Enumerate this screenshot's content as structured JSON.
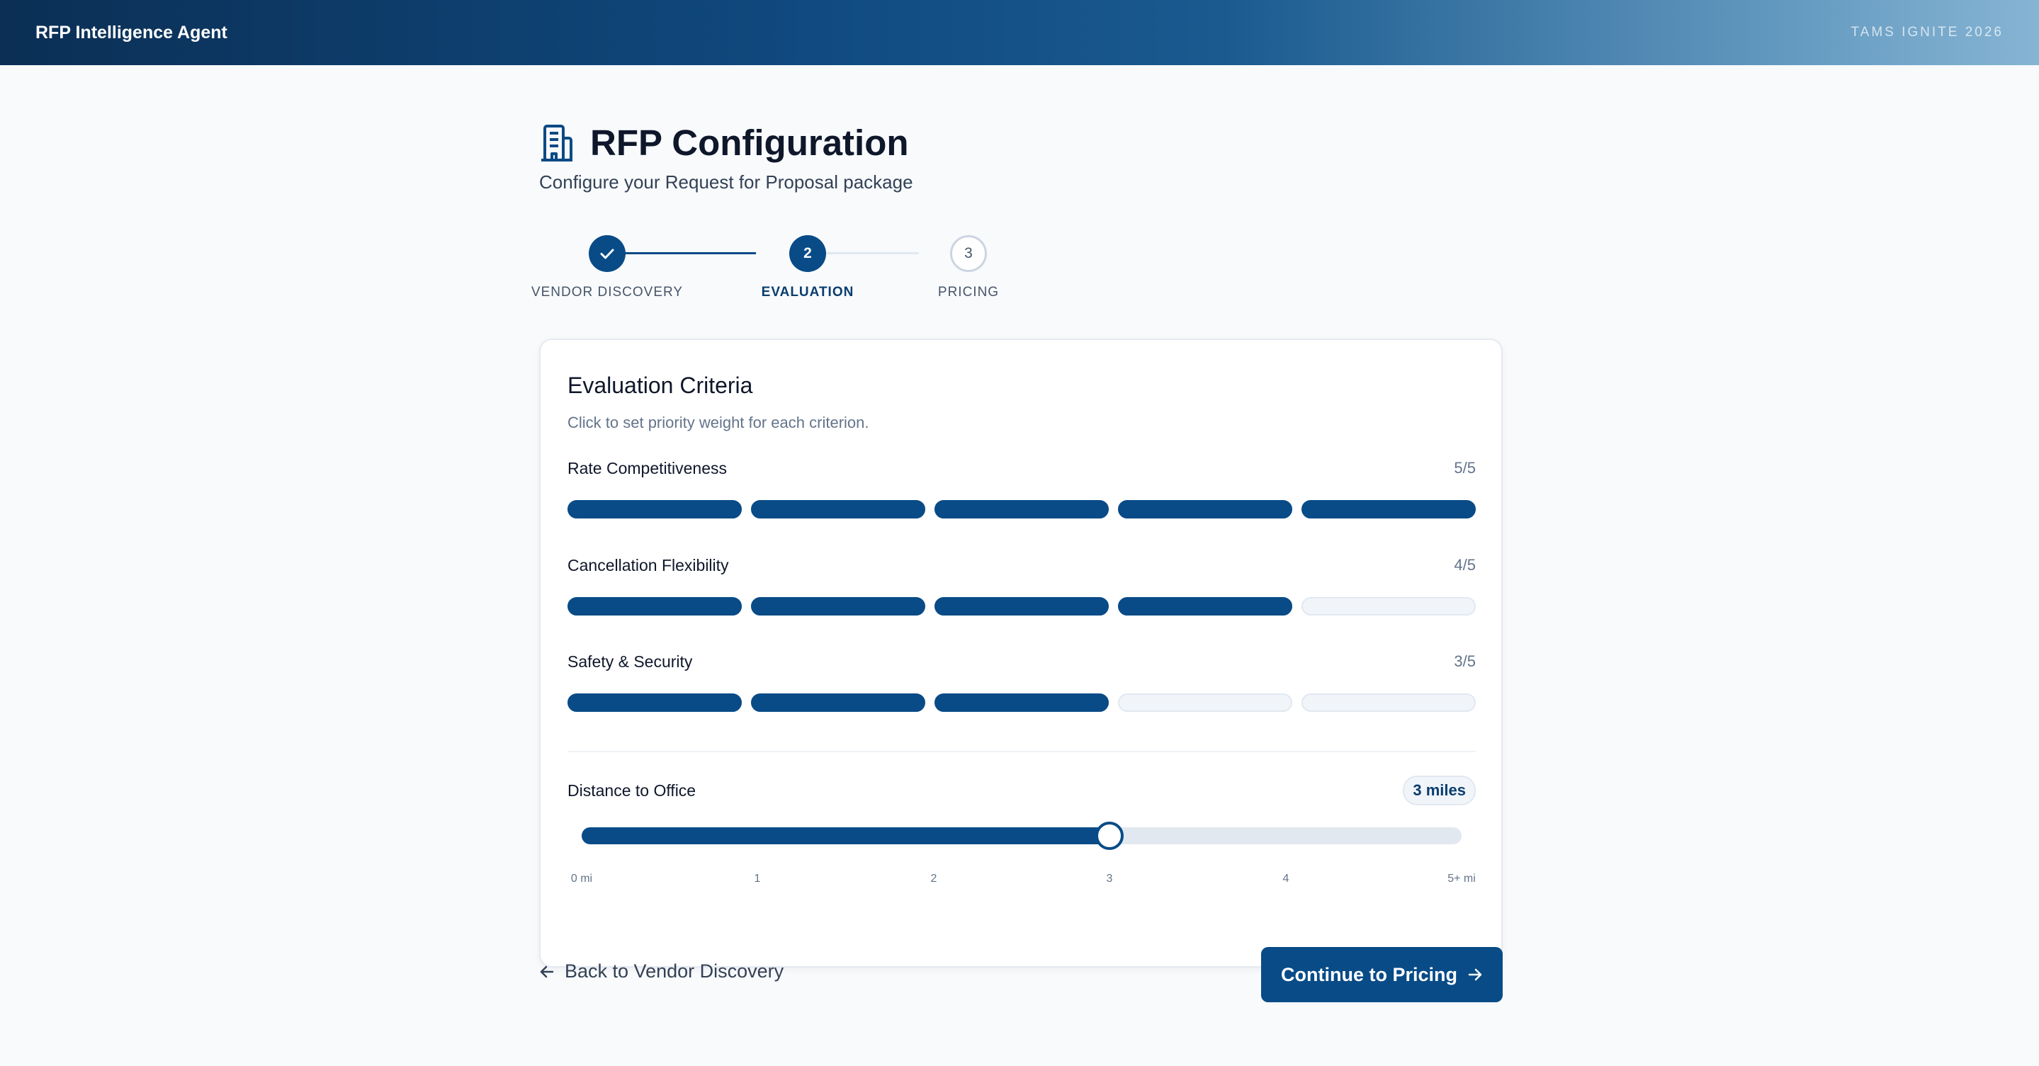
{
  "header": {
    "app_title": "RFP Intelligence Agent",
    "event_label": "TAMS IGNITE 2026"
  },
  "page": {
    "icon": "building-icon",
    "title": "RFP Configuration",
    "subtitle": "Configure your Request for Proposal package"
  },
  "stepper": {
    "steps": [
      {
        "number": "1",
        "label": "VENDOR DISCOVERY",
        "state": "complete",
        "icon": "check-icon"
      },
      {
        "number": "2",
        "label": "EVALUATION",
        "state": "active"
      },
      {
        "number": "3",
        "label": "PRICING",
        "state": "upcoming"
      }
    ]
  },
  "card": {
    "title": "Evaluation Criteria",
    "hint": "Click to set priority weight for each criterion.",
    "criteria": [
      {
        "label": "Rate Competitiveness",
        "score_text": "5/5",
        "value": 5,
        "max": 5
      },
      {
        "label": "Cancellation Flexibility",
        "score_text": "4/5",
        "value": 4,
        "max": 5
      },
      {
        "label": "Safety & Security",
        "score_text": "3/5",
        "value": 3,
        "max": 5
      }
    ],
    "distance": {
      "label": "Distance to Office",
      "badge": "3 miles",
      "value": 3,
      "min": 0,
      "max": 5,
      "ticks": [
        "0 mi",
        "1",
        "2",
        "3",
        "4",
        "5+ mi"
      ]
    }
  },
  "footer": {
    "back_label": "Back to Vendor Discovery",
    "continue_label": "Continue to Pricing"
  },
  "colors": {
    "primary": "#084b87",
    "track": "#e2e8f0",
    "text_muted": "#64748b"
  }
}
